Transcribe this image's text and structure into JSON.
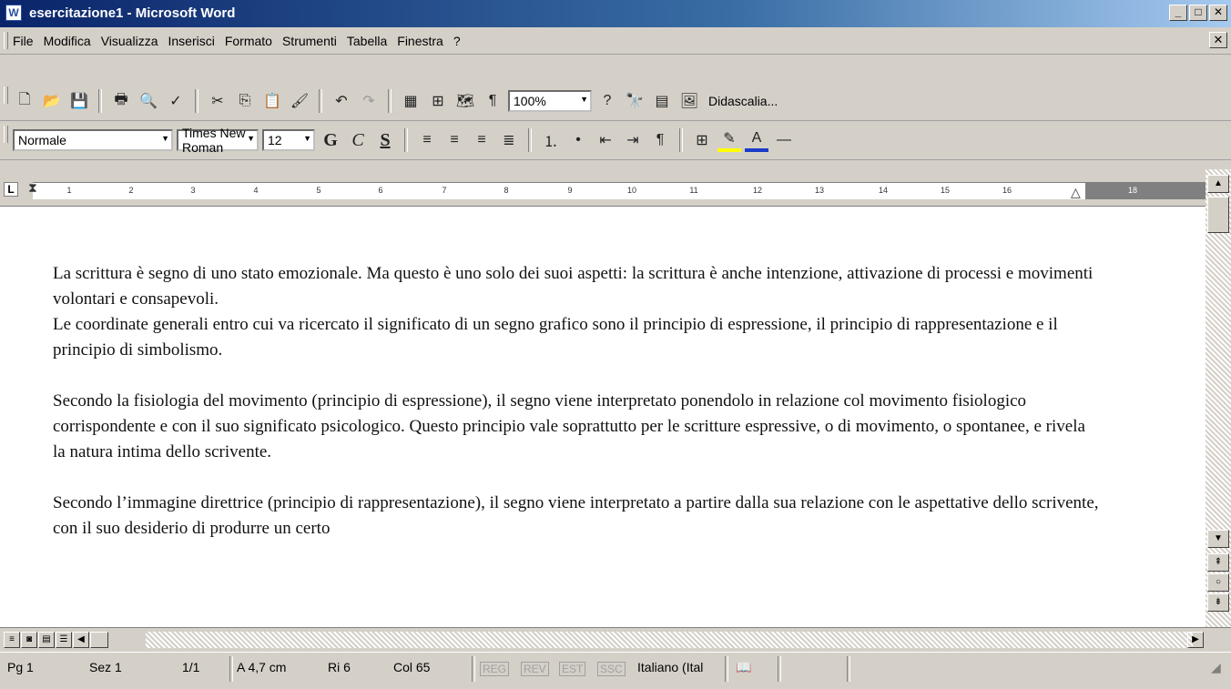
{
  "window": {
    "title": "esercitazione1 - Microsoft Word",
    "app_icon": "word-doc-icon",
    "buttons": [
      "minimize-icon",
      "maximize-icon",
      "close-icon"
    ]
  },
  "menubar": {
    "items": [
      "File",
      "Modifica",
      "Visualizza",
      "Inserisci",
      "Formato",
      "Strumenti",
      "Tabella",
      "Finestra",
      "?"
    ]
  },
  "standard_toolbar": {
    "zoom": "100%",
    "didascalia": "Didascalia..."
  },
  "format_toolbar": {
    "style": "Normale",
    "font": "Times New Roman",
    "size": "12",
    "bold": "G",
    "italic": "C",
    "underline": "S"
  },
  "ruler": {
    "marks": [
      "1",
      "2",
      "3",
      "4",
      "5",
      "6",
      "7",
      "8",
      "9",
      "10",
      "11",
      "12",
      "13",
      "14",
      "15",
      "16",
      "18"
    ]
  },
  "document": {
    "paragraphs": [
      "La scrittura è segno di uno stato emozionale. Ma questo è uno solo dei suoi aspetti: la scrittura è anche intenzione, attivazione di processi e movimenti volontari e consapevoli.\nLe coordinate generali entro cui va ricercato il significato di un segno grafico sono il principio di espressione, il principio di rappresentazione e il principio di simbolismo.",
      "Secondo la fisiologia del movimento (principio di espressione), il segno viene interpretato ponendolo in relazione col movimento fisiologico corrispondente e con il suo significato psicologico. Questo principio vale soprattutto per le scritture espressive, o di movimento, o spontanee, e rivela la natura intima dello scrivente.",
      "Secondo l’immagine direttrice (principio di rappresentazione), il segno viene interpretato a partire dalla sua relazione con le aspettative dello scrivente, con il suo desiderio di produrre un certo"
    ]
  },
  "statusbar": {
    "page": "Pg 1",
    "section": "Sez 1",
    "pages": "1/1",
    "position": "A 4,7 cm",
    "line": "Ri 6",
    "column": "Col 65",
    "rec": "REG",
    "rev": "REV",
    "ext": "EST",
    "ovr": "SSC",
    "language": "Italiano (Ital"
  }
}
